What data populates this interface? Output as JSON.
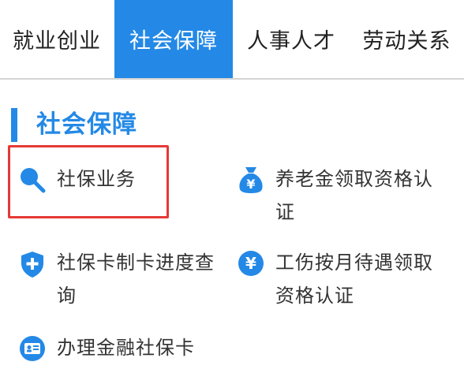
{
  "tabs": [
    {
      "label": "就业创业",
      "active": false
    },
    {
      "label": "社会保障",
      "active": true
    },
    {
      "label": "人事人才",
      "active": false
    },
    {
      "label": "劳动关系",
      "active": false
    }
  ],
  "section": {
    "title": "社会保障"
  },
  "items": [
    {
      "label": "社保业务",
      "icon": "search-icon"
    },
    {
      "label": "养老金领取资格认证",
      "icon": "money-bag-icon"
    },
    {
      "label": "社保卡制卡进度查询",
      "icon": "shield-plus-icon"
    },
    {
      "label": "工伤按月待遇领取资格认证",
      "icon": "yen-circle-icon"
    },
    {
      "label": "办理金融社保卡",
      "icon": "id-card-icon"
    }
  ],
  "colors": {
    "accent": "#2489e6",
    "highlight": "#e53935",
    "text": "#333333"
  }
}
